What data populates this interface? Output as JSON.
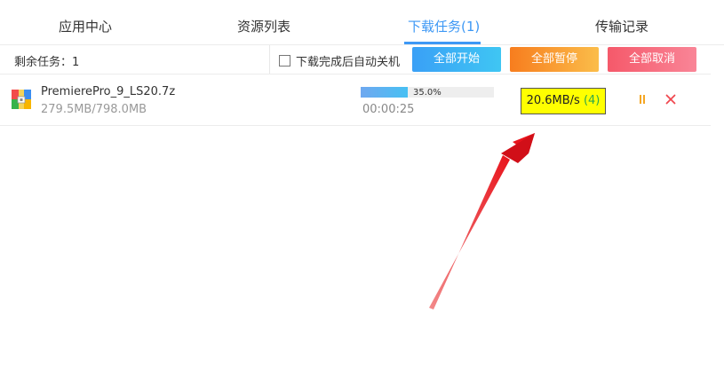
{
  "tabs": [
    {
      "label": "应用中心",
      "active": false
    },
    {
      "label": "资源列表",
      "active": false
    },
    {
      "label": "下载任务(1)",
      "active": true
    },
    {
      "label": "传输记录",
      "active": false
    }
  ],
  "toolbar": {
    "remaining_label": "剩余任务：1",
    "shutdown_label": "下载完成后自动关机",
    "shutdown_checked": false,
    "start_all_label": "全部开始",
    "pause_all_label": "全部暂停",
    "cancel_all_label": "全部取消"
  },
  "task": {
    "icon": "archive-file-icon",
    "file_name": "PremierePro_9_LS20.7z",
    "size_text": "279.5MB/798.0MB",
    "progress": 0.35,
    "progress_text": "35.0%",
    "time_text": "00:00:25",
    "speed": "20.6MB/s",
    "connections": "(4)"
  },
  "colors": {
    "accent": "#3d98f5",
    "speed_highlight": "#ffff00",
    "connections": "#2ea84a",
    "pause_icon": "#f5a623",
    "close_icon": "#f0474f",
    "arrow": "#e8141c"
  }
}
